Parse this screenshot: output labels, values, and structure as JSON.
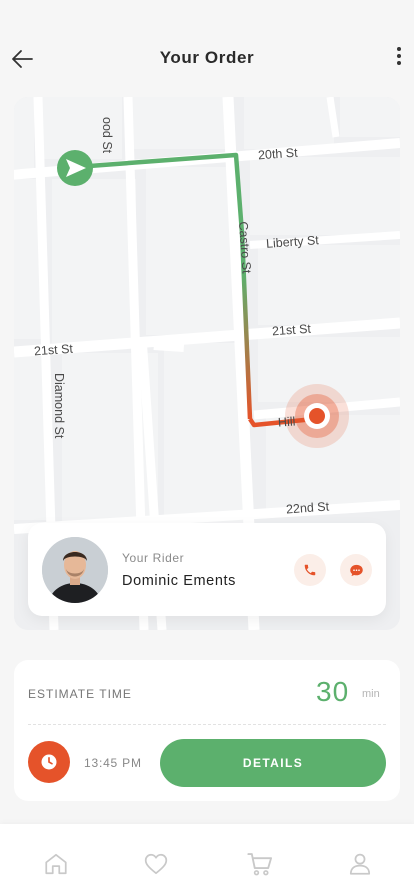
{
  "header": {
    "title": "Your Order",
    "back_icon": "arrow-left-icon",
    "menu_icon": "more-vertical-icon"
  },
  "map": {
    "streets": {
      "wood": "ood St",
      "twentieth": "20th St",
      "castro": "Castro St",
      "liberty": "Liberty St",
      "twentyfirst_right": "21st St",
      "twentyfirst_left": "21st St",
      "diamond": "Diamond St",
      "hill": "Hill",
      "twentysecond": "22nd St"
    },
    "route_colors": {
      "start": "#5cb06d",
      "end": "#e5532a"
    },
    "start_icon": "navigation-arrow-icon",
    "destination_icon": "location-target-icon"
  },
  "rider": {
    "caption": "Your Rider",
    "name": "Dominic Ements",
    "call_icon": "phone-icon",
    "chat_icon": "chat-bubble-icon"
  },
  "estimate": {
    "label": "ESTIMATE TIME",
    "value": "30",
    "unit": "min",
    "time": "13:45 PM",
    "details_label": "DETAILS",
    "clock_icon": "clock-icon"
  },
  "tabbar": {
    "items": [
      "home-icon",
      "heart-icon",
      "cart-icon",
      "profile-icon"
    ]
  },
  "colors": {
    "accent_green": "#5cb06d",
    "accent_orange": "#e5532a"
  }
}
